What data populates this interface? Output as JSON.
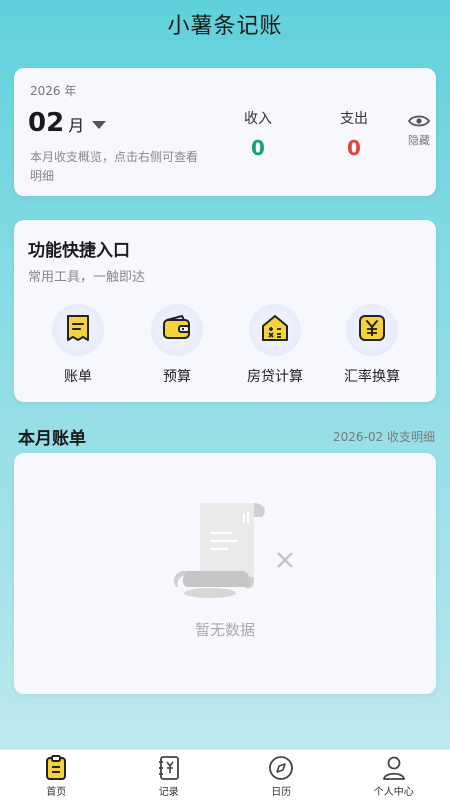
{
  "app": {
    "title": "小薯条记账"
  },
  "summary": {
    "year": "2026 年",
    "month": "02",
    "month_unit": "月",
    "hint": "本月收支概览，点击右侧可查看明细",
    "income_label": "收入",
    "income_value": "0",
    "expense_label": "支出",
    "expense_value": "0",
    "hide_label": "隐藏"
  },
  "quick": {
    "title": "功能快捷入口",
    "subtitle": "常用工具，一触即达",
    "tools": [
      {
        "label": "账单",
        "icon": "bill-icon"
      },
      {
        "label": "预算",
        "icon": "wallet-icon"
      },
      {
        "label": "房贷计算",
        "icon": "house-calc-icon"
      },
      {
        "label": "汇率换算",
        "icon": "yen-icon"
      }
    ]
  },
  "bills": {
    "title": "本月账单",
    "link": "2026-02 收支明细",
    "empty_text": "暂无数据"
  },
  "nav": {
    "items": [
      {
        "label": "首页",
        "icon": "clipboard-icon",
        "active": true
      },
      {
        "label": "记录",
        "icon": "notebook-icon"
      },
      {
        "label": "日历",
        "icon": "compass-icon"
      },
      {
        "label": "个人中心",
        "icon": "user-icon"
      }
    ]
  },
  "colors": {
    "income": "#1e9e74",
    "expense": "#d9493d",
    "accent_yellow": "#f5d33d",
    "background": "#5fd1dc"
  }
}
